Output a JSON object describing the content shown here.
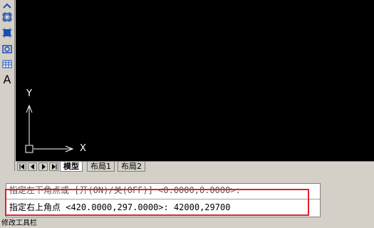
{
  "left_toolbar": {
    "tools": [
      {
        "icon": "move-up-icon"
      },
      {
        "icon": "hatch-icon"
      },
      {
        "icon": "region-icon"
      },
      {
        "icon": "circle-rect-icon"
      },
      {
        "icon": "table-icon"
      },
      {
        "icon": "text-icon",
        "glyph": "A"
      }
    ]
  },
  "canvas": {
    "ucs_y_label": "Y",
    "ucs_x_label": "X",
    "background": "#000000",
    "ucs_color": "#ffffff"
  },
  "tabs": {
    "nav_buttons": [
      "first-icon",
      "prev-icon",
      "next-icon",
      "last-icon"
    ],
    "items": [
      {
        "label": "模型",
        "active": true
      },
      {
        "label": "布局1",
        "active": false
      },
      {
        "label": "布局2",
        "active": false
      }
    ]
  },
  "command": {
    "line1": "指定左下角点或 [开(ON)/关(OFF)] <0.0000,0.0000>:",
    "line2": "指定右上角点 <420.0000,297.0000>: 42000,29700",
    "highlight_color": "#e0202a"
  },
  "status": {
    "text": "修改工具栏"
  }
}
